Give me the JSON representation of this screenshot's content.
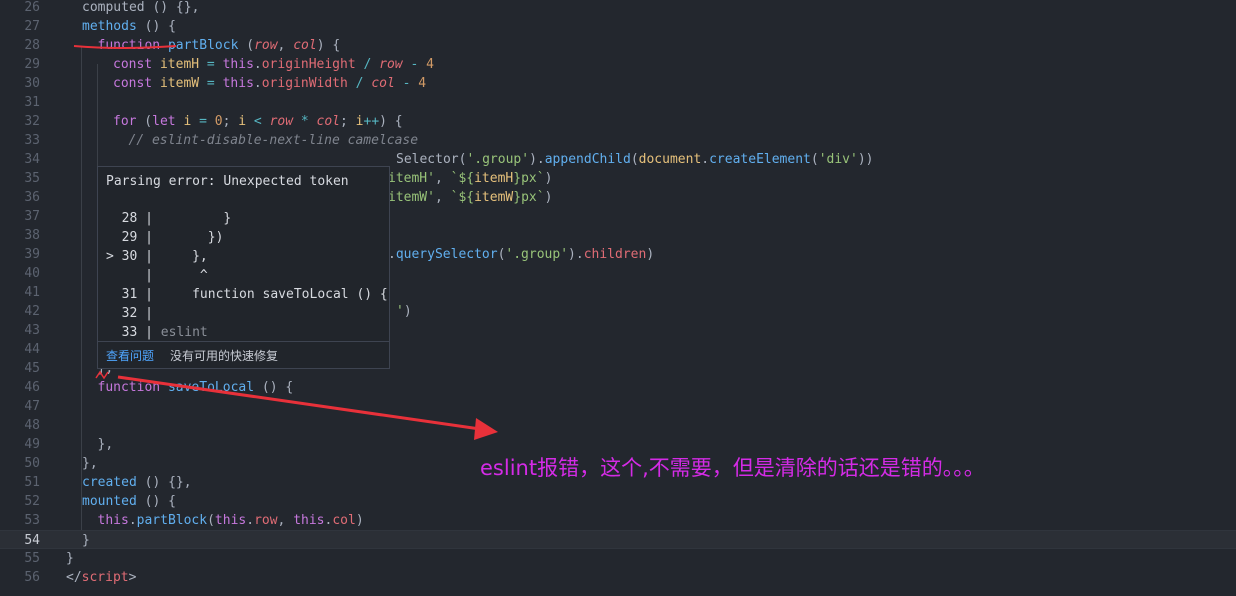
{
  "editor": {
    "active_line": "54",
    "lines": [
      {
        "n": "26",
        "segs": [
          [
            "pl",
            "computed () {},"
          ]
        ]
      },
      {
        "n": "27",
        "segs": [
          [
            "f",
            "methods"
          ],
          [
            "pl",
            " () {"
          ]
        ]
      },
      {
        "n": "28",
        "segs": [
          [
            "k",
            "function "
          ],
          [
            "f",
            "partBlock"
          ],
          [
            "pl",
            " ("
          ],
          [
            "p",
            "row"
          ],
          [
            "pl",
            ", "
          ],
          [
            "p",
            "col"
          ],
          [
            "pl",
            ") {"
          ]
        ]
      },
      {
        "n": "29",
        "segs": [
          [
            "k",
            "const "
          ],
          [
            "v",
            "itemH"
          ],
          [
            "o",
            " = "
          ],
          [
            "t",
            "this"
          ],
          [
            "pl",
            "."
          ],
          [
            "pr",
            "originHeight"
          ],
          [
            "o",
            " / "
          ],
          [
            "p",
            "row"
          ],
          [
            "o",
            " - "
          ],
          [
            "n",
            "4"
          ]
        ]
      },
      {
        "n": "30",
        "segs": [
          [
            "k",
            "const "
          ],
          [
            "v",
            "itemW"
          ],
          [
            "o",
            " = "
          ],
          [
            "t",
            "this"
          ],
          [
            "pl",
            "."
          ],
          [
            "pr",
            "originWidth"
          ],
          [
            "o",
            " / "
          ],
          [
            "p",
            "col"
          ],
          [
            "o",
            " - "
          ],
          [
            "n",
            "4"
          ]
        ]
      },
      {
        "n": "31",
        "segs": []
      },
      {
        "n": "32",
        "segs": [
          [
            "k",
            "for"
          ],
          [
            "pl",
            " ("
          ],
          [
            "k",
            "let "
          ],
          [
            "v",
            "i"
          ],
          [
            "o",
            " = "
          ],
          [
            "n",
            "0"
          ],
          [
            "pl",
            "; "
          ],
          [
            "v",
            "i"
          ],
          [
            "o",
            " < "
          ],
          [
            "p",
            "row"
          ],
          [
            "o",
            " * "
          ],
          [
            "p",
            "col"
          ],
          [
            "pl",
            "; "
          ],
          [
            "v",
            "i"
          ],
          [
            "o",
            "++"
          ],
          [
            "pl",
            ") {"
          ]
        ]
      },
      {
        "n": "33",
        "segs": [
          [
            "c",
            "// eslint-disable-next-line camelcase"
          ]
        ]
      },
      {
        "n": "34",
        "segs": [
          [
            "pl",
            "Selector("
          ],
          [
            "s",
            "'.group'"
          ],
          [
            "pl",
            ")."
          ],
          [
            "f",
            "appendChild"
          ],
          [
            "pl",
            "("
          ],
          [
            "v",
            "document"
          ],
          [
            "pl",
            "."
          ],
          [
            "f",
            "createElement"
          ],
          [
            "pl",
            "("
          ],
          [
            "s",
            "'div'"
          ],
          [
            "pl",
            "))"
          ]
        ]
      },
      {
        "n": "35",
        "segs": [
          [
            "s",
            "itemH'"
          ],
          [
            "pl",
            ", "
          ],
          [
            "s",
            "`${"
          ],
          [
            "v",
            "itemH"
          ],
          [
            "s",
            "}px`"
          ],
          [
            "pl",
            ")"
          ]
        ]
      },
      {
        "n": "36",
        "segs": [
          [
            "s",
            "itemW'"
          ],
          [
            "pl",
            ", "
          ],
          [
            "s",
            "`${"
          ],
          [
            "v",
            "itemW"
          ],
          [
            "s",
            "}px`"
          ],
          [
            "pl",
            ")"
          ]
        ]
      },
      {
        "n": "37",
        "segs": []
      },
      {
        "n": "38",
        "segs": []
      },
      {
        "n": "39",
        "segs": [
          [
            "pl",
            "."
          ],
          [
            "f",
            "querySelector"
          ],
          [
            "pl",
            "("
          ],
          [
            "s",
            "'.group'"
          ],
          [
            "pl",
            ")."
          ],
          [
            "pr",
            "children"
          ],
          [
            "pl",
            ")"
          ]
        ]
      },
      {
        "n": "40",
        "segs": []
      },
      {
        "n": "41",
        "segs": []
      },
      {
        "n": "42",
        "segs": [
          [
            "s",
            "'"
          ],
          [
            "pl",
            ")"
          ]
        ]
      },
      {
        "n": "43",
        "segs": []
      },
      {
        "n": "44",
        "segs": []
      },
      {
        "n": "45",
        "segs": [
          [
            "pl",
            "},"
          ]
        ]
      },
      {
        "n": "46",
        "segs": [
          [
            "k",
            "function "
          ],
          [
            "f",
            "saveToLocal"
          ],
          [
            "pl",
            " () {"
          ]
        ]
      },
      {
        "n": "47",
        "segs": []
      },
      {
        "n": "48",
        "segs": []
      },
      {
        "n": "49",
        "segs": [
          [
            "pl",
            "},"
          ]
        ]
      },
      {
        "n": "50",
        "segs": [
          [
            "pl",
            "},"
          ]
        ]
      },
      {
        "n": "51",
        "segs": [
          [
            "f",
            "created"
          ],
          [
            "pl",
            " () {},"
          ]
        ]
      },
      {
        "n": "52",
        "segs": [
          [
            "f",
            "mounted"
          ],
          [
            "pl",
            " () {"
          ]
        ]
      },
      {
        "n": "53",
        "segs": [
          [
            "t",
            "this"
          ],
          [
            "pl",
            "."
          ],
          [
            "f",
            "partBlock"
          ],
          [
            "pl",
            "("
          ],
          [
            "t",
            "this"
          ],
          [
            "pl",
            "."
          ],
          [
            "pr",
            "row"
          ],
          [
            "pl",
            ", "
          ],
          [
            "t",
            "this"
          ],
          [
            "pl",
            "."
          ],
          [
            "pr",
            "col"
          ],
          [
            "pl",
            ")"
          ]
        ]
      },
      {
        "n": "54",
        "segs": [
          [
            "pl",
            "}"
          ]
        ]
      },
      {
        "n": "55",
        "segs": [
          [
            "pl",
            "}"
          ]
        ]
      },
      {
        "n": "56",
        "segs": [
          [
            "pl",
            "</"
          ],
          [
            "pr",
            "script"
          ],
          [
            "pl",
            ">"
          ]
        ]
      }
    ]
  },
  "hover": {
    "title": "Parsing error: Unexpected token",
    "frame": [
      "  28 |         }",
      "  29 |       })",
      "> 30 |     },",
      "     |      ^",
      "  31 |     function saveToLocal () {",
      "  32 |",
      "  33 | "
    ],
    "source": "eslint",
    "view_problem": "查看问题",
    "no_fix": "没有可用的快速修复"
  },
  "annotation": {
    "note": "eslint报错，这个,不需要，但是清除的话还是错的。。。",
    "color": "#d42be6",
    "arrow_color": "#e8313a"
  }
}
